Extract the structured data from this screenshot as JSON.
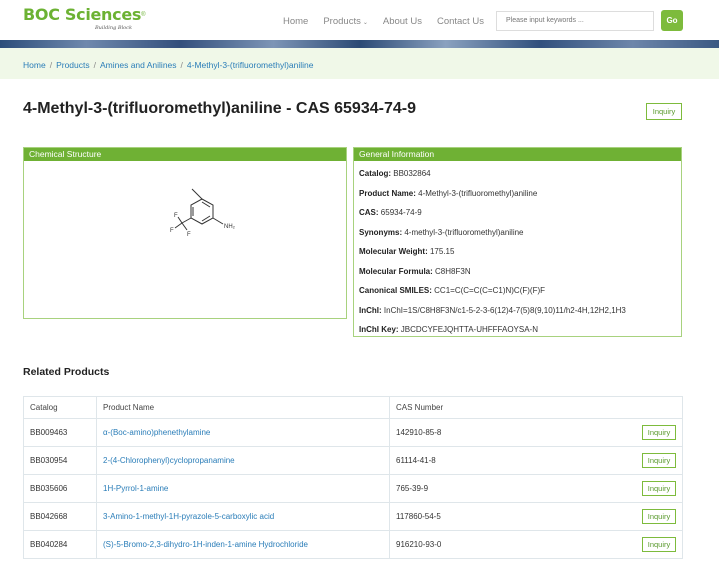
{
  "header": {
    "logo_text": "BOC Sciences",
    "logo_tagline": "Building Block",
    "nav": [
      {
        "label": "Home"
      },
      {
        "label": "Products",
        "has_dropdown": true
      },
      {
        "label": "About Us"
      },
      {
        "label": "Contact Us"
      }
    ],
    "search_placeholder": "Please input keywords ...",
    "go_label": "Go"
  },
  "breadcrumb": {
    "items": [
      "Home",
      "Products",
      "Amines and Anilines",
      "4-Methyl-3-(trifluoromethyl)aniline"
    ],
    "separator": "/"
  },
  "page": {
    "title": "4-Methyl-3-(trifluoromethyl)aniline - CAS 65934-74-9",
    "inquiry_label": "Inquiry"
  },
  "structure": {
    "heading": "Chemical Structure",
    "labels": {
      "f1": "F",
      "f2": "F",
      "f3": "F",
      "nh2": "NH₂"
    }
  },
  "general": {
    "heading": "General Information",
    "rows": [
      {
        "key": "Catalog:",
        "value": "BB032864"
      },
      {
        "key": "Product Name:",
        "value": "4-Methyl-3-(trifluoromethyl)aniline"
      },
      {
        "key": "CAS:",
        "value": "65934-74-9"
      },
      {
        "key": "Synonyms:",
        "value": "4-methyl-3-(trifluoromethyl)aniline"
      },
      {
        "key": "Molecular Weight:",
        "value": "175.15"
      },
      {
        "key": "Molecular Formula:",
        "value": "C8H8F3N"
      },
      {
        "key": "Canonical SMILES:",
        "value": "CC1=C(C=C(C=C1)N)C(F)(F)F"
      },
      {
        "key": "InChI:",
        "value": "InChI=1S/C8H8F3N/c1-5-2-3-6(12)4-7(5)8(9,10)11/h2-4H,12H2,1H3"
      },
      {
        "key": "InChI Key:",
        "value": "JBCDCYFEJQHTTA-UHFFFAOYSA-N"
      }
    ]
  },
  "related": {
    "heading": "Related Products",
    "columns": [
      "Catalog",
      "Product Name",
      "CAS Number"
    ],
    "inquiry_label": "Inquiry",
    "rows": [
      {
        "catalog": "BB009463",
        "name": "α-(Boc-amino)phenethylamine",
        "cas": "142910-85-8"
      },
      {
        "catalog": "BB030954",
        "name": "2-(4-Chlorophenyl)cyclopropanamine",
        "cas": "61114-41-8"
      },
      {
        "catalog": "BB035606",
        "name": "1H-Pyrrol-1-amine",
        "cas": "765-39-9"
      },
      {
        "catalog": "BB042668",
        "name": "3-Amino-1-methyl-1H-pyrazole-5-carboxylic acid",
        "cas": "117860-54-5"
      },
      {
        "catalog": "BB040284",
        "name": "(S)-5-Bromo-2,3-dihydro-1H-inden-1-amine Hydrochloride",
        "cas": "916210-93-0"
      }
    ]
  },
  "colors": {
    "brand_green": "#6fb134",
    "link_blue": "#2a7db8",
    "breadcrumb_bg": "#f0f8e8"
  }
}
